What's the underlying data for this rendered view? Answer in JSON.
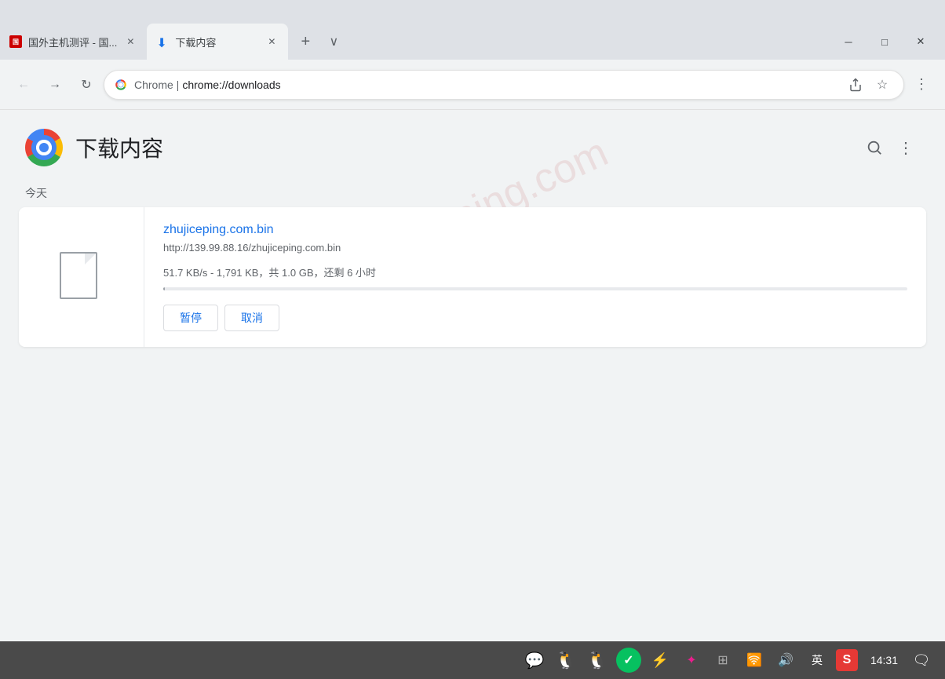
{
  "window": {
    "title": "下载内容"
  },
  "tabs": [
    {
      "id": "tab1",
      "title": "国外主机测评 - 国...",
      "active": false,
      "favicon": "red-square"
    },
    {
      "id": "tab2",
      "title": "下载内容",
      "active": true,
      "favicon": "download"
    }
  ],
  "window_controls": {
    "chevron": "∨",
    "minimize": "─",
    "maximize": "□",
    "close": "✕"
  },
  "nav": {
    "back_disabled": false,
    "forward_disabled": false,
    "address": "chrome://downloads",
    "address_display": "Chrome | chrome://downloads"
  },
  "downloads_page": {
    "title": "下载内容",
    "section_label": "今天",
    "search_label": "搜索",
    "more_actions_label": "更多操作",
    "watermark": "zhujiceping.com"
  },
  "download_item": {
    "filename": "zhujiceping.com.bin",
    "url": "http://139.99.88.16/zhujiceping.com.bin",
    "progress_text": "51.7 KB/s - 1,791 KB，共 1.0 GB，还剩 6 小时",
    "progress_percent": 0.17,
    "pause_label": "暂停",
    "cancel_label": "取消"
  },
  "taskbar": {
    "icons": [
      {
        "name": "wechat",
        "symbol": "💬",
        "color": "#07c160"
      },
      {
        "name": "qq1",
        "symbol": "🐧",
        "color": "#12b7f5"
      },
      {
        "name": "qq2",
        "symbol": "🐧",
        "color": "#12b7f5"
      },
      {
        "name": "checkmark",
        "symbol": "✓",
        "color": "#07c160"
      },
      {
        "name": "bluetooth",
        "symbol": "⚡",
        "color": "#0082FC"
      },
      {
        "name": "game",
        "symbol": "✦",
        "color": "#e91e8c"
      },
      {
        "name": "screen",
        "symbol": "⊞",
        "color": "#aaa"
      },
      {
        "name": "wifi",
        "symbol": "🛜",
        "color": "#fff"
      },
      {
        "name": "volume",
        "symbol": "🔊",
        "color": "#fff"
      },
      {
        "name": "lang",
        "symbol": "英",
        "color": "#fff"
      },
      {
        "name": "sougou",
        "symbol": "S",
        "color": "#e53935"
      }
    ],
    "clock": "14:31",
    "notification": "🗨"
  }
}
